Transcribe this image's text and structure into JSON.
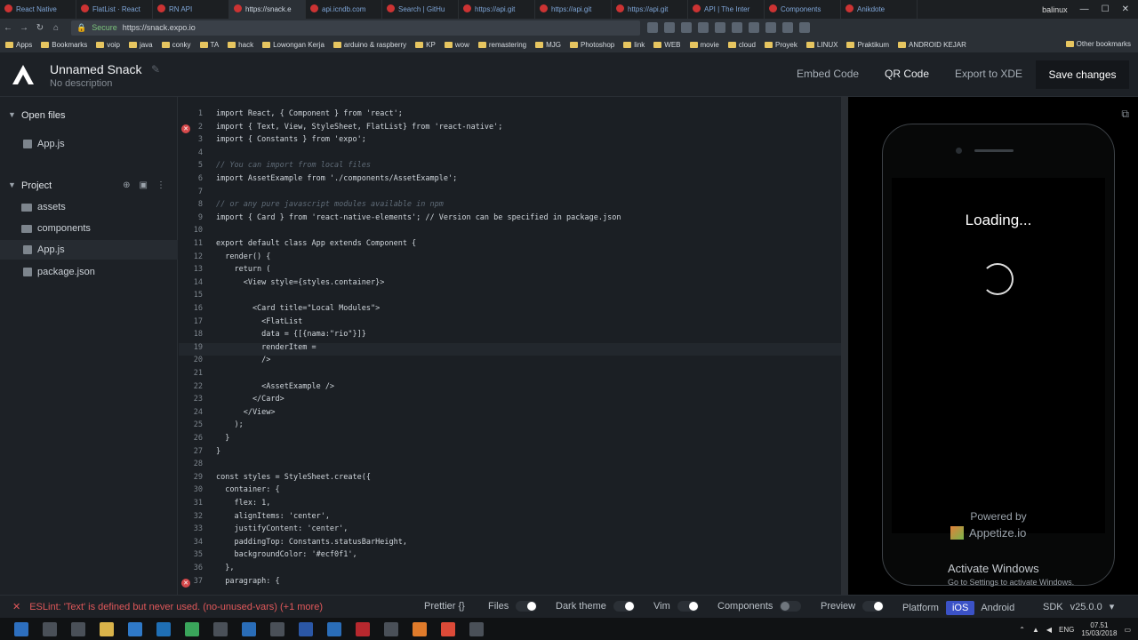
{
  "browser": {
    "tabs": [
      "React Native",
      "FlatList · React",
      "RN API",
      "https://snack.e",
      "api.icndb.com",
      "Search | GitHu",
      "https://api.git",
      "https://api.git",
      "https://api.git",
      "API | The Inter",
      "Components",
      "Anikdote"
    ],
    "active_tab": 3,
    "window_user": "balinux",
    "secure_label": "Secure",
    "url": "https://snack.expo.io",
    "bookmarks": [
      "Apps",
      "Bookmarks",
      "voip",
      "java",
      "conky",
      "TA",
      "hack",
      "Lowongan Kerja",
      "arduino & raspberry",
      "KP",
      "wow",
      "remastering",
      "MJG",
      "Photoshop",
      "link",
      "WEB",
      "movie",
      "cloud",
      "Proyek",
      "LINUX",
      "Praktikum",
      "ANDROID KEJAR"
    ],
    "other_bookmarks": "Other bookmarks"
  },
  "header": {
    "title": "Unnamed Snack",
    "description": "No description",
    "embed_code": "Embed Code",
    "qr_code": "QR Code",
    "export": "Export to XDE",
    "save": "Save changes"
  },
  "sidebar": {
    "open_files": "Open files",
    "open_file": "App.js",
    "project": "Project",
    "project_items": [
      "assets",
      "components",
      "App.js",
      "package.json"
    ]
  },
  "editor": {
    "lines": [
      {
        "n": "1",
        "text": "import React, { Component } from 'react';"
      },
      {
        "n": "2",
        "text": "import { Text, View, StyleSheet, FlatList} from 'react-native';",
        "error": true
      },
      {
        "n": "3",
        "text": "import { Constants } from 'expo';"
      },
      {
        "n": "4",
        "text": ""
      },
      {
        "n": "5",
        "text": "// You can import from local files",
        "comment": true
      },
      {
        "n": "6",
        "text": "import AssetExample from './components/AssetExample';"
      },
      {
        "n": "7",
        "text": ""
      },
      {
        "n": "8",
        "text": "// or any pure javascript modules available in npm",
        "comment": true
      },
      {
        "n": "9",
        "text": "import { Card } from 'react-native-elements'; // Version can be specified in package.json"
      },
      {
        "n": "10",
        "text": ""
      },
      {
        "n": "11",
        "text": "export default class App extends Component {"
      },
      {
        "n": "12",
        "text": "  render() {"
      },
      {
        "n": "13",
        "text": "    return ("
      },
      {
        "n": "14",
        "text": "      <View style={styles.container}>"
      },
      {
        "n": "15",
        "text": ""
      },
      {
        "n": "16",
        "text": "        <Card title=\"Local Modules\">"
      },
      {
        "n": "17",
        "text": "          <FlatList"
      },
      {
        "n": "18",
        "text": "          data = {[{nama:\"rio\"}]}"
      },
      {
        "n": "19",
        "text": "          renderItem =",
        "cursor": true
      },
      {
        "n": "20",
        "text": "          />"
      },
      {
        "n": "21",
        "text": ""
      },
      {
        "n": "22",
        "text": "          <AssetExample />"
      },
      {
        "n": "23",
        "text": "        </Card>"
      },
      {
        "n": "24",
        "text": "      </View>"
      },
      {
        "n": "25",
        "text": "    );"
      },
      {
        "n": "26",
        "text": "  }"
      },
      {
        "n": "27",
        "text": "}"
      },
      {
        "n": "28",
        "text": ""
      },
      {
        "n": "29",
        "text": "const styles = StyleSheet.create({"
      },
      {
        "n": "30",
        "text": "  container: {"
      },
      {
        "n": "31",
        "text": "    flex: 1,"
      },
      {
        "n": "32",
        "text": "    alignItems: 'center',"
      },
      {
        "n": "33",
        "text": "    justifyContent: 'center',"
      },
      {
        "n": "34",
        "text": "    paddingTop: Constants.statusBarHeight,"
      },
      {
        "n": "35",
        "text": "    backgroundColor: '#ecf0f1',"
      },
      {
        "n": "36",
        "text": "  },"
      },
      {
        "n": "37",
        "text": "  paragraph: {",
        "error": true
      }
    ]
  },
  "preview": {
    "loading": "Loading...",
    "powered_by": "Powered by",
    "appetize": "Appetize.io",
    "activate_title": "Activate Windows",
    "activate_sub": "Go to Settings to activate Windows."
  },
  "status": {
    "lint": "ESLint: 'Text' is defined but never used. (no-unused-vars) (+1 more)",
    "prettier": "Prettier {}",
    "files": "Files",
    "dark_theme": "Dark theme",
    "vim": "Vim",
    "components": "Components",
    "preview": "Preview",
    "platform": "Platform",
    "ios": "iOS",
    "android": "Android",
    "sdk": "SDK",
    "sdk_version": "v25.0.0"
  },
  "taskbar": {
    "lang": "ENG",
    "time": "07.51",
    "date": "15/03/2018"
  },
  "colors": {
    "accent": "#3b52c7",
    "error": "#d6494b"
  }
}
